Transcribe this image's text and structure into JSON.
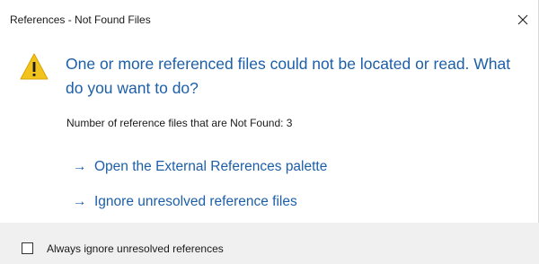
{
  "window": {
    "title": "References - Not Found Files",
    "close_icon": "close-icon"
  },
  "content": {
    "warning_icon": "warning-icon",
    "main_instruction": "One or more referenced files could not be located or read. What do you want to do?",
    "count_text": "Number of reference files that are Not Found: 3"
  },
  "commands": [
    {
      "arrow": "→",
      "label": "Open the External References palette"
    },
    {
      "arrow": "→",
      "label": "Ignore unresolved reference files"
    }
  ],
  "footer": {
    "checkbox_checked": false,
    "checkbox_label": "Always ignore unresolved references"
  },
  "colors": {
    "link": "#1c5fa8",
    "warning_fill": "#f2c31c",
    "footer_bg": "#f0f0f0"
  }
}
